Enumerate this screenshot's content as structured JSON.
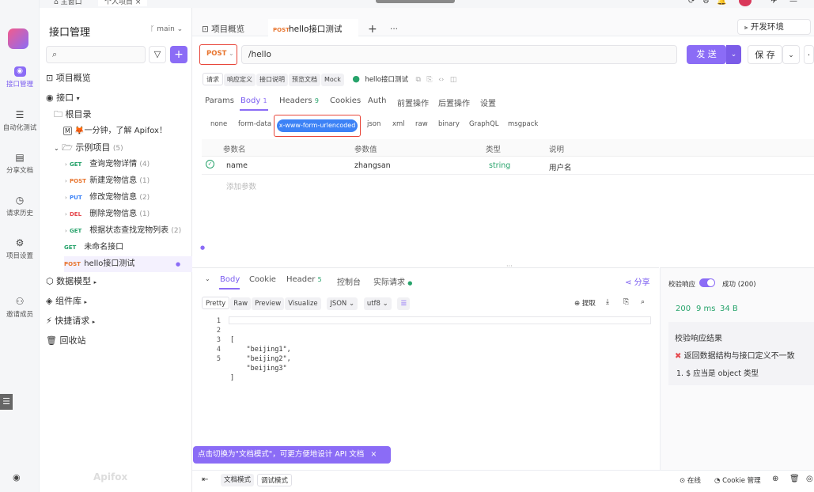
{
  "top_tabs": {
    "home": "主窗口",
    "project": "个人项目"
  },
  "rail": {
    "items": [
      "接口管理",
      "自动化测试",
      "分享文档",
      "请求历史",
      "项目设置",
      "邀请成员"
    ]
  },
  "tree": {
    "title": "接口管理",
    "branch": "main",
    "items": {
      "overview": "项目概览",
      "api": "接口",
      "root": "根目录",
      "intro": "🦊一分钟，了解 Apifox！",
      "example": "示例项目",
      "example_count": "(5)",
      "apis": [
        {
          "method": "GET",
          "name": "查询宠物详情",
          "count": "(4)"
        },
        {
          "method": "POST",
          "name": "新建宠物信息",
          "count": "(1)"
        },
        {
          "method": "PUT",
          "name": "修改宠物信息",
          "count": "(2)"
        },
        {
          "method": "DEL",
          "name": "删除宠物信息",
          "count": "(1)"
        },
        {
          "method": "GET",
          "name": "根据状态查找宠物列表",
          "count": "(2)"
        }
      ],
      "unnamed_method": "GET",
      "unnamed": "未命名接口",
      "hello_method": "POST",
      "hello": "hello接口测试",
      "models": "数据模型",
      "components": "组件库",
      "quick": "快捷请求",
      "trash": "回收站"
    },
    "logo": "Apifox"
  },
  "main_tabs": {
    "overview": "项目概览",
    "active_method": "POST",
    "active": "hello接口测试",
    "env": "开发环境"
  },
  "request": {
    "method": "POST",
    "url": "/hello",
    "send": "发 送",
    "save": "保 存"
  },
  "doc_tabs": [
    "请求",
    "响应定义",
    "接口说明",
    "预览文档",
    "Mock"
  ],
  "api_name": "hello接口测试",
  "param_tabs": {
    "params": "Params",
    "body": "Body",
    "body_count": "1",
    "headers": "Headers",
    "headers_count": "9",
    "cookies": "Cookies",
    "auth": "Auth",
    "pre": "前置操作",
    "post": "后置操作",
    "settings": "设置"
  },
  "body_types": [
    "none",
    "form-data",
    "x-www-form-urlencoded",
    "json",
    "xml",
    "raw",
    "binary",
    "GraphQL",
    "msgpack"
  ],
  "table": {
    "headers": [
      "参数名",
      "参数值",
      "类型",
      "说明"
    ],
    "row": {
      "name": "name",
      "value": "zhangsan",
      "type": "string",
      "desc": "用户名"
    },
    "add": "添加参数"
  },
  "response": {
    "tabs": {
      "body": "Body",
      "cookie": "Cookie",
      "header": "Header",
      "header_count": "5",
      "console": "控制台",
      "actual": "实际请求"
    },
    "share": "分享",
    "views": [
      "Pretty",
      "Raw",
      "Preview",
      "Visualize"
    ],
    "format": "JSON",
    "encoding": "utf8",
    "extract": "提取",
    "lines": [
      "1",
      "2",
      "3",
      "4",
      "5"
    ],
    "code": [
      "[",
      "    \"beijing1\",",
      "    \"beijing2\",",
      "    \"beijing3\"",
      "]"
    ]
  },
  "validation": {
    "label": "校验响应",
    "status": "成功 (200)",
    "code": "200",
    "time": "9 ms",
    "size": "34 B",
    "result_title": "校验响应结果",
    "error": "返回数据结构与接口定义不一致",
    "detail": "1. $ 应当是 object 类型"
  },
  "toast": {
    "text": "点击切换为\"文档模式\"，可更方便地设计 API 文档"
  },
  "statusbar": {
    "doc_mode": "文档模式",
    "debug_mode": "调试模式",
    "online": "在线",
    "cookie": "Cookie 管理"
  }
}
